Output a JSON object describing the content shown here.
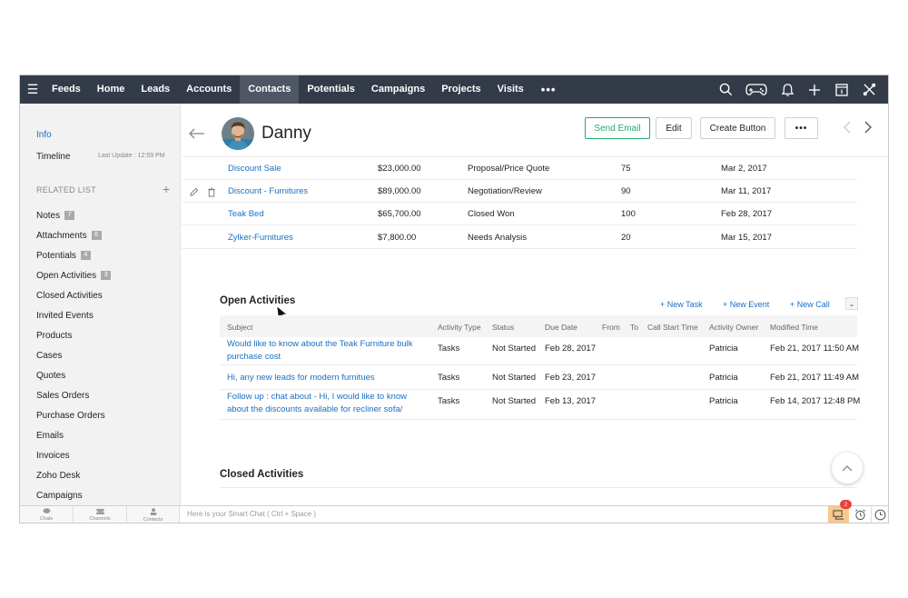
{
  "nav": {
    "tabs": [
      "Feeds",
      "Home",
      "Leads",
      "Accounts",
      "Contacts",
      "Potentials",
      "Campaigns",
      "Projects",
      "Visits"
    ],
    "active_tab": "Contacts",
    "more": "•••",
    "icons": [
      "search-icon",
      "gamepad-icon",
      "bell-icon",
      "plus-icon",
      "calendar-icon",
      "tools-icon"
    ]
  },
  "sidebar": {
    "info": "Info",
    "timeline": "Timeline",
    "last_update": "Last Update : 12:59 PM",
    "related_list": "RELATED LIST",
    "items": [
      {
        "label": "Notes",
        "count": "7"
      },
      {
        "label": "Attachments",
        "count": "6"
      },
      {
        "label": "Potentials",
        "count": "4"
      },
      {
        "label": "Open Activities",
        "count": "3"
      },
      {
        "label": "Closed Activities",
        "count": ""
      },
      {
        "label": "Invited Events",
        "count": ""
      },
      {
        "label": "Products",
        "count": ""
      },
      {
        "label": "Cases",
        "count": ""
      },
      {
        "label": "Quotes",
        "count": ""
      },
      {
        "label": "Sales Orders",
        "count": ""
      },
      {
        "label": "Purchase Orders",
        "count": ""
      },
      {
        "label": "Emails",
        "count": ""
      },
      {
        "label": "Invoices",
        "count": ""
      },
      {
        "label": "Zoho Desk",
        "count": ""
      },
      {
        "label": "Campaigns",
        "count": ""
      }
    ]
  },
  "header": {
    "name": "Danny",
    "send_email": "Send Email",
    "edit": "Edit",
    "create_button": "Create Button",
    "more": "•••"
  },
  "potentials": [
    {
      "name": "Discount Sale",
      "amount": "$23,000.00",
      "stage": "Proposal/Price Quote",
      "probability": "75",
      "date": "Mar 2, 2017"
    },
    {
      "name": "Discount - Furnitures",
      "amount": "$89,000.00",
      "stage": "Negotiation/Review",
      "probability": "90",
      "date": "Mar 11, 2017"
    },
    {
      "name": "Teak Bed",
      "amount": "$65,700.00",
      "stage": "Closed Won",
      "probability": "100",
      "date": "Feb 28, 2017"
    },
    {
      "name": "Zylker-Furnitures",
      "amount": "$7,800.00",
      "stage": "Needs Analysis",
      "probability": "20",
      "date": "Mar 15, 2017"
    }
  ],
  "open_activities": {
    "title": "Open Activities",
    "new_task": "New Task",
    "new_event": "New Event",
    "new_call": "New Call",
    "columns": {
      "subject": "Subject",
      "type": "Activity Type",
      "status": "Status",
      "due": "Due Date",
      "from": "From",
      "to": "To",
      "call_start": "Call Start Time",
      "owner": "Activity Owner",
      "modified": "Modified Time"
    },
    "rows": [
      {
        "subject": "Would like to know about the Teak Furniture bulk purchase cost",
        "type": "Tasks",
        "status": "Not Started",
        "due": "Feb 28, 2017",
        "owner": "Patricia",
        "modified": "Feb 21, 2017 11:50 AM"
      },
      {
        "subject": "Hi, any new leads for modern furnitues",
        "type": "Tasks",
        "status": "Not Started",
        "due": "Feb 23, 2017",
        "owner": "Patricia",
        "modified": "Feb 21, 2017 11:49 AM"
      },
      {
        "subject": "Follow up : chat about - Hi, I would like to know about the discounts available for recliner sofa/",
        "type": "Tasks",
        "status": "Not Started",
        "due": "Feb 13, 2017",
        "owner": "Patricia",
        "modified": "Feb 14, 2017 12:48 PM"
      }
    ]
  },
  "closed_activities": {
    "title": "Closed Activities"
  },
  "bottombar": {
    "chats": "Chats",
    "channels": "Channels",
    "contacts": "Contacts",
    "chat_placeholder": "Here is your Smart Chat ( Ctrl + Space )",
    "badge": "2"
  },
  "colors": {
    "nav_bg": "#343b48",
    "link": "#1a6fc1",
    "accent_green": "#23a86f",
    "badge_red": "#e8413c"
  }
}
